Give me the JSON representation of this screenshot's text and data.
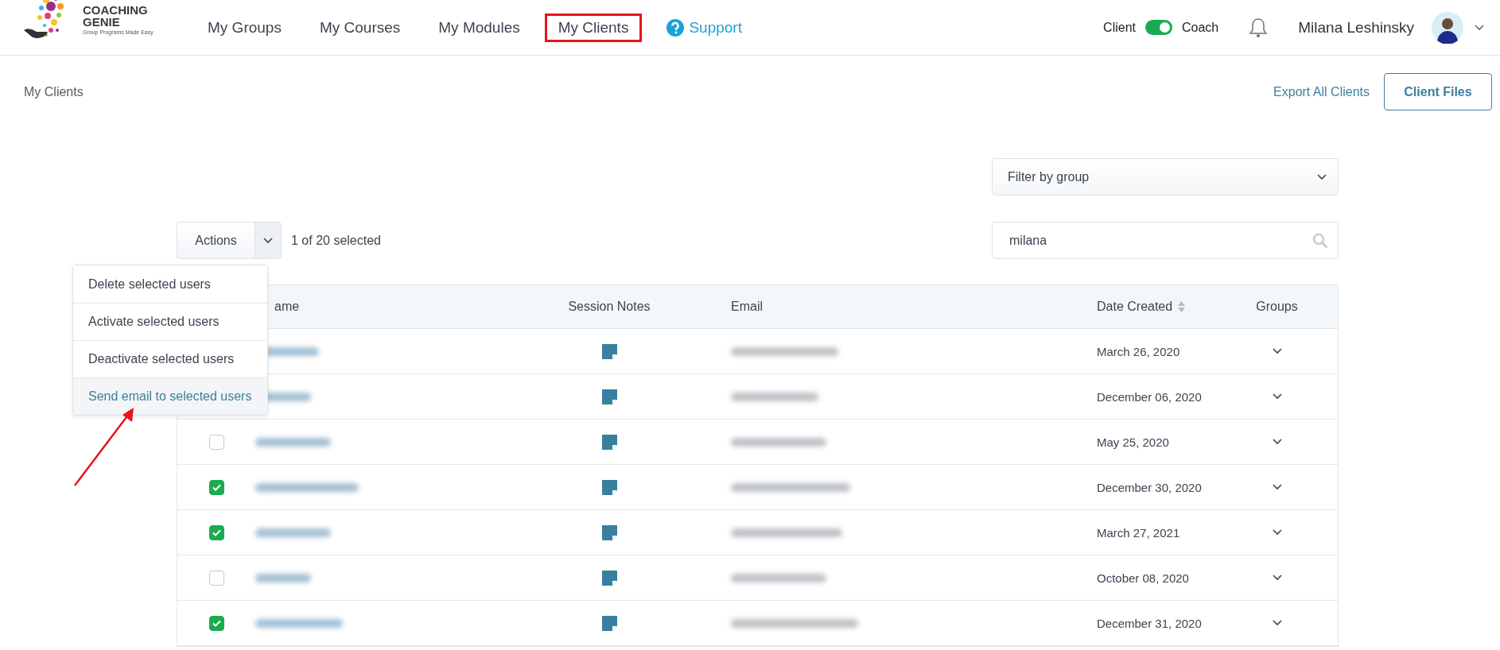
{
  "logo": {
    "name_line_1": "COACHING",
    "name_line_2": "GENIE",
    "tagline": "Group Programs Made Easy"
  },
  "nav": [
    {
      "label": "My Groups",
      "selected": false,
      "kind": "link"
    },
    {
      "label": "My Courses",
      "selected": false,
      "kind": "link"
    },
    {
      "label": "My Modules",
      "selected": false,
      "kind": "link"
    },
    {
      "label": "My Clients",
      "selected": true,
      "kind": "link"
    },
    {
      "label": "Support",
      "selected": false,
      "kind": "help"
    }
  ],
  "mode_switch": {
    "left_label": "Client",
    "right_label": "Coach",
    "on": true
  },
  "user": {
    "name": "Milana Leshinsky"
  },
  "breadcrumb": "My Clients",
  "export_link": "Export All Clients",
  "client_files_button": "Client Files",
  "filter": {
    "placeholder": "Filter by group"
  },
  "search": {
    "value": "milana"
  },
  "actions": {
    "label": "Actions",
    "selection_count": "1 of 20 selected",
    "expanded": true,
    "menu": [
      {
        "label": "Delete selected users",
        "selected": false
      },
      {
        "label": "Activate selected users",
        "selected": false
      },
      {
        "label": "Deactivate selected users",
        "selected": false
      },
      {
        "label": "Send email to selected users",
        "selected": true
      }
    ]
  },
  "table": {
    "columns": [
      "ame",
      "Session Notes",
      "Email",
      "Date Created",
      "Groups"
    ],
    "rows": [
      {
        "date": "March 26, 2020"
      },
      {
        "date": "December 06, 2020"
      },
      {
        "checked": false,
        "date": "May 25, 2020"
      },
      {
        "checked": true,
        "date": "December 30, 2020"
      },
      {
        "checked": true,
        "date": "March 27, 2021"
      },
      {
        "checked": false,
        "date": "October 08, 2020"
      },
      {
        "checked": true,
        "date": "December 31, 2020"
      }
    ]
  }
}
